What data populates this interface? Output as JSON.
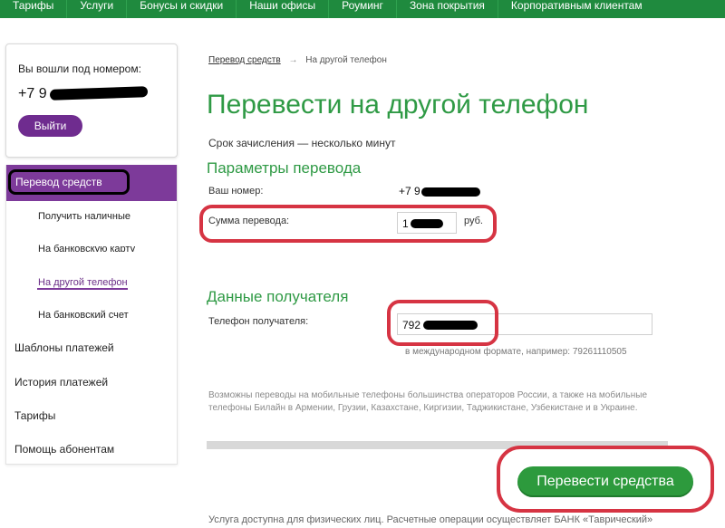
{
  "topnav": {
    "items": [
      "Тарифы",
      "Услуги",
      "Бонусы и скидки",
      "Наши офисы",
      "Роуминг",
      "Зона покрытия",
      "Корпоративным клиентам"
    ]
  },
  "login": {
    "label": "Вы вошли под номером:",
    "phone_prefix": "+7 9",
    "logout_label": "Выйти"
  },
  "sidebar": {
    "active": "Перевод средств",
    "submenu": [
      "Получить наличные",
      "На банковскую карту",
      "На другой телефон",
      "На банковский счет"
    ],
    "current_submenu": "На другой телефон",
    "items": [
      "Шаблоны платежей",
      "История платежей",
      "Тарифы",
      "Помощь абонентам"
    ]
  },
  "breadcrumb": {
    "link": "Перевод средств",
    "arrow": "→",
    "current": "На другой телефон"
  },
  "page": {
    "title": "Перевести на другой телефон",
    "subtitle": "Срок зачисления — несколько минут"
  },
  "params": {
    "title": "Параметры перевода",
    "your_number_label": "Ваш номер:",
    "your_number_prefix": "+7 9",
    "amount_label": "Сумма перевода:",
    "amount_value": "1",
    "currency": "руб."
  },
  "recipient": {
    "title": "Данные получателя",
    "phone_label": "Телефон получателя:",
    "phone_value": "792",
    "hint": "в международном формате, например: 79261110505"
  },
  "note": "Возможны переводы на мобильные телефоны большинства операторов России, а также на мобильные телефоны Билайн в Армении, Грузии, Казахстане, Киргизии, Таджикистане, Узбекистане и в Украине.",
  "submit_label": "Перевести средства",
  "footer": "Услуга доступна для физических лиц. Расчетные операции осуществляет БАНК «Таврический»",
  "colors": {
    "brand_green": "#2f9a45",
    "nav_green": "#1f8a3e",
    "accent_purple": "#7d3a9a",
    "annotation_red": "#d63443"
  }
}
